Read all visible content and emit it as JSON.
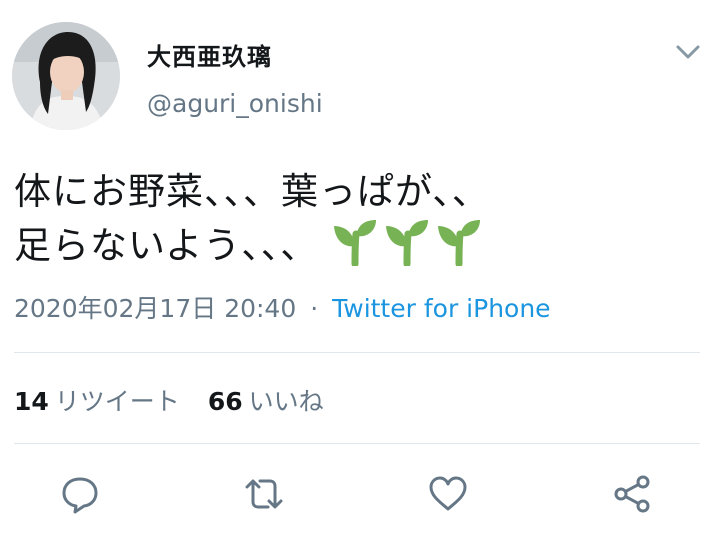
{
  "user": {
    "display_name": "大西亜玖璃",
    "handle": "@aguri_onishi",
    "avatar_icon": "profile-photo"
  },
  "tweet": {
    "line1": "体にお野菜、、、葉っぱが、、",
    "line2": "足らないよう、、、",
    "emoji": [
      "🌱",
      "🌱",
      "🌱"
    ]
  },
  "meta": {
    "datetime": "2020年02月17日 20:40",
    "separator": "·",
    "source": "Twitter for iPhone"
  },
  "stats": {
    "retweets_count": "14",
    "retweets_label": "リツイート",
    "likes_count": "66",
    "likes_label": "いいね"
  },
  "actions": [
    "reply-icon",
    "retweet-icon",
    "like-icon",
    "share-icon"
  ],
  "colors": {
    "text": "#14171a",
    "secondary": "#657786",
    "link": "#1b95e0",
    "divider": "#e1e8ed",
    "sprout": "#77b255"
  }
}
